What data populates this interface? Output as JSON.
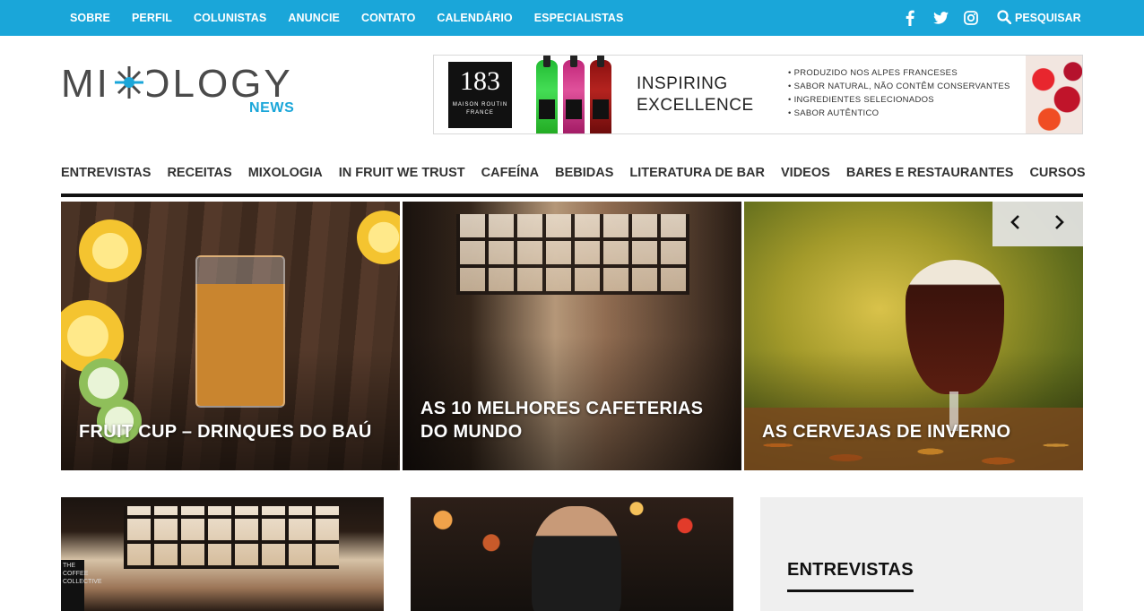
{
  "topbar": {
    "nav": [
      "SOBRE",
      "PERFIL",
      "COLUNISTAS",
      "ANUNCIE",
      "CONTATO",
      "CALENDÁRIO",
      "ESPECIALISTAS"
    ],
    "social": [
      "facebook-icon",
      "twitter-icon",
      "instagram-icon"
    ],
    "search_label": "PESQUISAR",
    "bg_color": "#1aa6d9"
  },
  "logo": {
    "word": "MIXOLOGY",
    "sub": "NEWS"
  },
  "banner": {
    "brand_number": "183",
    "brand_sub": "MAISON ROUTIN",
    "brand_country": "FRANCE",
    "headline_1": "INSPIRING",
    "headline_2": "EXCELLENCE",
    "bullets": [
      "PRODUZIDO NOS ALPES FRANCESES",
      "SABOR NATURAL, NÃO CONTÊM CONSERVANTES",
      "INGREDIENTES SELECIONADOS",
      "SABOR AUTÊNTICO"
    ]
  },
  "mainnav": [
    "ENTREVISTAS",
    "RECEITAS",
    "MIXOLOGIA",
    "IN FRUIT WE TRUST",
    "CAFEÍNA",
    "BEBIDAS",
    "LITERATURA DE BAR",
    "VIDEOS",
    "BARES E RESTAURANTES",
    "CURSOS"
  ],
  "slider": {
    "slides": [
      {
        "caption": "FRUIT CUP – DRINQUES DO BAÚ"
      },
      {
        "caption": "AS 10 MELHORES CAFETERIAS DO MUNDO"
      },
      {
        "caption": "AS CERVEJAS DE INVERNO"
      }
    ],
    "prev_icon": "chevron-left-icon",
    "next_icon": "chevron-right-icon"
  },
  "cards": {
    "sign_text": "THE COFFEE COLLECTIVE"
  },
  "sidebar": {
    "title": "ENTREVISTAS"
  }
}
